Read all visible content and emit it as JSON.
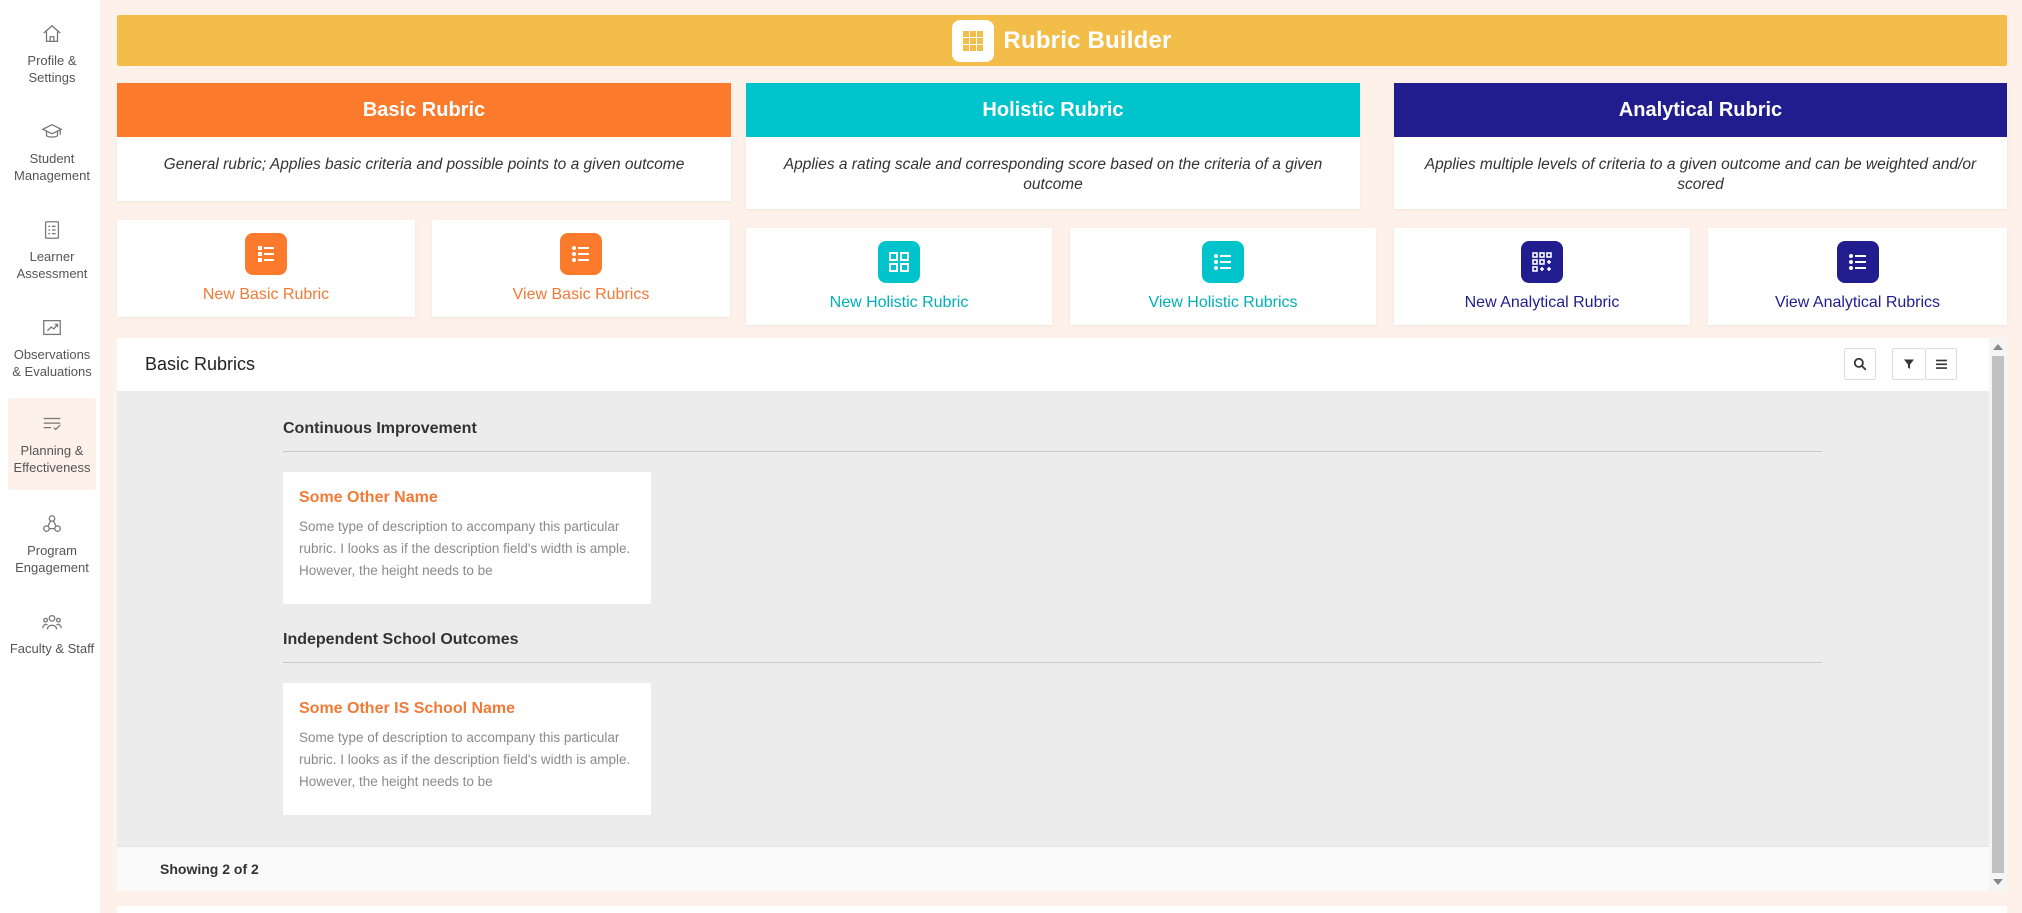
{
  "sidebar": {
    "items": [
      {
        "label": "Profile & Settings",
        "icon": "home-icon"
      },
      {
        "label": "Student Management",
        "icon": "graduation-cap-icon"
      },
      {
        "label": "Learner Assessment",
        "icon": "clipboard-icon"
      },
      {
        "label": "Observations & Evaluations",
        "icon": "easel-icon"
      },
      {
        "label": "Planning & Effectiveness",
        "icon": "checklist-icon",
        "active": true
      },
      {
        "label": "Program Engagement",
        "icon": "network-icon"
      },
      {
        "label": "Faculty & Staff",
        "icon": "people-icon"
      }
    ]
  },
  "banner": {
    "title": "Rubric Builder",
    "icon": "grid-icon"
  },
  "colors": {
    "banner": "#f2bd48",
    "basic": "#fb7a2c",
    "holistic": "#00c4cc",
    "analytical": "#211d8f",
    "rubric_name": "#f07a36"
  },
  "rubric_types": [
    {
      "title": "Basic Rubric",
      "description": "General rubric; Applies basic criteria and possible points to a given outcome",
      "actions": [
        {
          "label": "New Basic Rubric",
          "icon": "list-icon"
        },
        {
          "label": "View Basic Rubrics",
          "icon": "bullet-list-icon"
        }
      ]
    },
    {
      "title": "Holistic Rubric",
      "description": "Applies a rating scale and corresponding score based on the criteria of a given outcome",
      "actions": [
        {
          "label": "New Holistic Rubric",
          "icon": "four-squares-icon"
        },
        {
          "label": "View Holistic Rubrics",
          "icon": "bullet-list-icon"
        }
      ]
    },
    {
      "title": "Analytical Rubric",
      "description": "Applies multiple levels of criteria to a given outcome and can be weighted and/or scored",
      "actions": [
        {
          "label": "New Analytical Rubric",
          "icon": "grid-plus-icon"
        },
        {
          "label": "View Analytical Rubrics",
          "icon": "bullet-list-icon"
        }
      ]
    }
  ],
  "panel": {
    "title": "Basic Rubrics",
    "groups": [
      {
        "title": "Continuous Improvement",
        "rubrics": [
          {
            "name": "Some Other Name",
            "description": "Some type of description to accompany this particular rubric. I looks as if the description field's width is ample. However, the height needs to be"
          }
        ]
      },
      {
        "title": "Independent School Outcomes",
        "rubrics": [
          {
            "name": "Some Other IS School Name",
            "description": "Some type of description to accompany this particular rubric. I looks as if the description field's width is ample. However, the height needs to be"
          }
        ]
      }
    ],
    "footer": "Showing 2 of 2"
  }
}
